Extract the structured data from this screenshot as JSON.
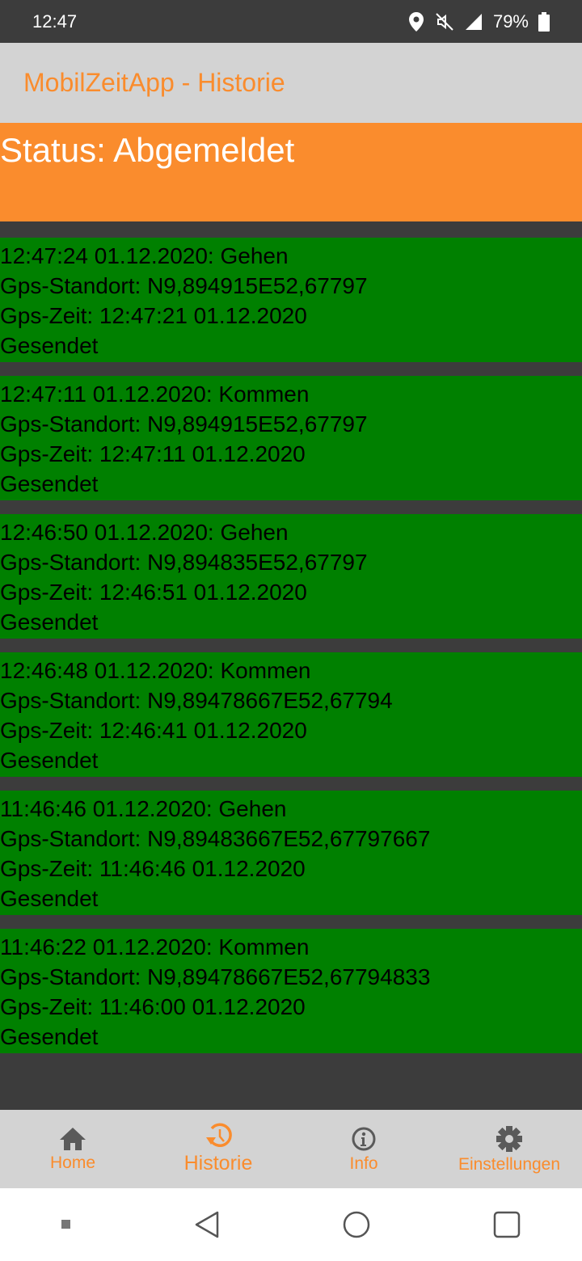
{
  "statusbar": {
    "time": "12:47",
    "battery": "79%",
    "icons": [
      "location-icon",
      "mute-icon",
      "lte-signal-icon",
      "battery-icon"
    ]
  },
  "app": {
    "title": "MobilZeitApp - Historie"
  },
  "status": {
    "text": "Status: Abgemeldet"
  },
  "colors": {
    "accent": "#fa8c2d",
    "entry": "#008000",
    "appbar": "#d3d3d3",
    "background": "#3c3c3c"
  },
  "entries": [
    {
      "header": "12:47:24 01.12.2020: Gehen",
      "location": "Gps-Standort: N9,894915E52,67797",
      "gps_time": "Gps-Zeit: 12:47:21 01.12.2020",
      "state": "Gesendet"
    },
    {
      "header": "12:47:11 01.12.2020: Kommen",
      "location": "Gps-Standort: N9,894915E52,67797",
      "gps_time": "Gps-Zeit: 12:47:11 01.12.2020",
      "state": "Gesendet"
    },
    {
      "header": "12:46:50 01.12.2020: Gehen",
      "location": "Gps-Standort: N9,894835E52,67797",
      "gps_time": "Gps-Zeit: 12:46:51 01.12.2020",
      "state": "Gesendet"
    },
    {
      "header": "12:46:48 01.12.2020: Kommen",
      "location": "Gps-Standort: N9,89478667E52,67794",
      "gps_time": "Gps-Zeit: 12:46:41 01.12.2020",
      "state": "Gesendet"
    },
    {
      "header": "11:46:46 01.12.2020: Gehen",
      "location": "Gps-Standort: N9,89483667E52,67797667",
      "gps_time": "Gps-Zeit: 11:46:46 01.12.2020",
      "state": "Gesendet"
    },
    {
      "header": "11:46:22 01.12.2020: Kommen",
      "location": "Gps-Standort: N9,89478667E52,67794833",
      "gps_time": "Gps-Zeit: 11:46:00 01.12.2020",
      "state": "Gesendet"
    }
  ],
  "nav": {
    "tabs": [
      {
        "label": "Home",
        "icon": "home-icon"
      },
      {
        "label": "Historie",
        "icon": "history-icon",
        "active": true
      },
      {
        "label": "Info",
        "icon": "info-icon"
      },
      {
        "label": "Einstellungen",
        "icon": "gear-icon"
      }
    ]
  }
}
